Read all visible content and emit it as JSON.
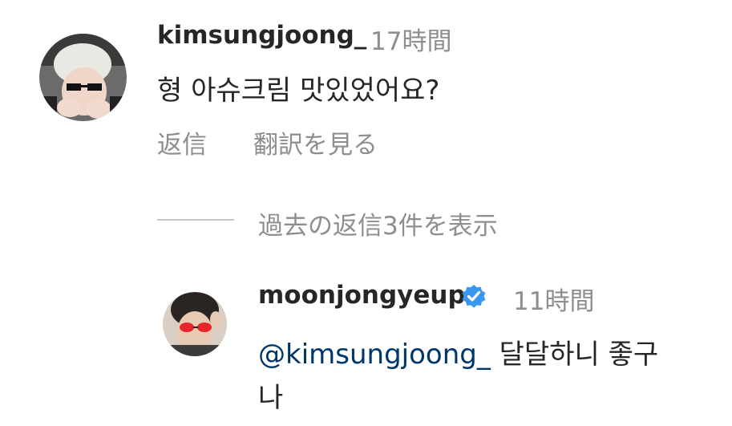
{
  "comment": {
    "username": "kimsungjoong_",
    "time": "17時間",
    "text": "형 아슈크림 맛있었어요?",
    "reply_label": "返信",
    "translate_label": "翻訳を見る"
  },
  "replies_toggle": {
    "label": "過去の返信3件を表示"
  },
  "reply": {
    "username": "moonjongyeup",
    "verified_icon": "verified-badge-icon",
    "time": "11時間",
    "mention": "@kimsungjoong_",
    "text_line1": "달달하니 좋구",
    "text_line2": "나"
  },
  "colors": {
    "text": "#262626",
    "muted": "#8e8e8e",
    "mention": "#00376b",
    "verified": "#3897f0"
  }
}
